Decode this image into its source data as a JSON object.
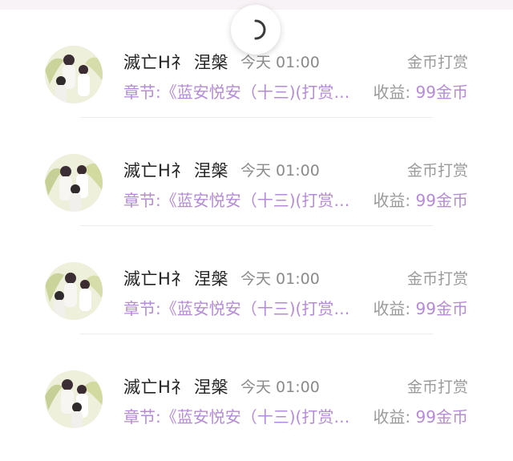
{
  "items": [
    {
      "user_name": "滅亡H礻 涅槃",
      "time": "今天 01:00",
      "type": "金币打赏",
      "chapter": "章节:《蓝安悦安（十三)(打赏加更)》",
      "income_label": "收益:",
      "income_value": "99金币"
    },
    {
      "user_name": "滅亡H礻 涅槃",
      "time": "今天 01:00",
      "type": "金币打赏",
      "chapter": "章节:《蓝安悦安（十三)(打赏加更)》",
      "income_label": "收益:",
      "income_value": "99金币"
    },
    {
      "user_name": "滅亡H礻 涅槃",
      "time": "今天 01:00",
      "type": "金币打赏",
      "chapter": "章节:《蓝安悦安（十三)(打赏加更)》",
      "income_label": "收益:",
      "income_value": "99金币"
    },
    {
      "user_name": "滅亡H礻 涅槃",
      "time": "今天 01:00",
      "type": "金币打赏",
      "chapter": "章节:《蓝安悦安（十三)(打赏加更)》",
      "income_label": "收益:",
      "income_value": "99金币"
    }
  ],
  "colors": {
    "accent": "#b48bd6",
    "secondary_text": "#9a9a9a",
    "primary_text": "#222222"
  },
  "icons": {
    "refresh": "loading-spinner-icon",
    "avatar": "user-avatar"
  }
}
